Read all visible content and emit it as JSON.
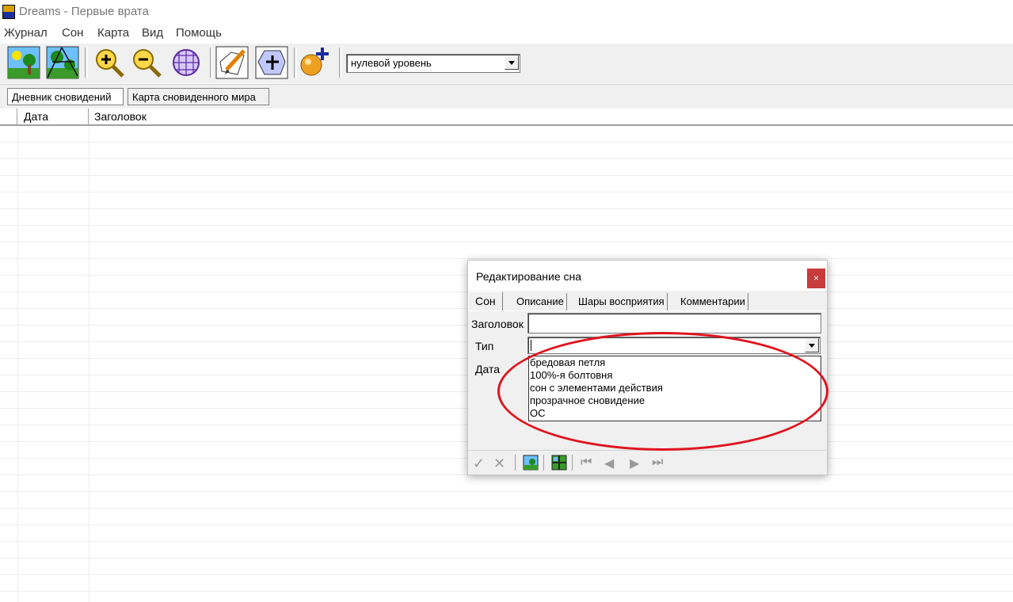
{
  "window": {
    "title": "Dreams - Первые врата"
  },
  "menu": [
    "Журнал",
    "Сон",
    "Карта",
    "Вид",
    "Помощь"
  ],
  "toolbar": {
    "level_value": "нулевой уровень"
  },
  "main_tabs": [
    {
      "label": "Дневник сновидений"
    },
    {
      "label": "Карта сновиденного мира"
    }
  ],
  "list": {
    "columns": [
      "Дата",
      "Заголовок"
    ]
  },
  "dialog": {
    "title": "Редактирование сна",
    "close": "×",
    "tabs": [
      "Сон",
      "Описание",
      "Шары восприятия",
      "Комментарии"
    ],
    "labels": {
      "title": "Заголовок",
      "type": "Тип",
      "date": "Дата"
    },
    "type_options": [
      "бредовая петля",
      "100%-я болтовня",
      "сон с элементами действия",
      "прозрачное сновидение",
      "ОС"
    ]
  },
  "colors": {
    "annotation": "#e0141e",
    "close_button": "#c93c3c"
  }
}
